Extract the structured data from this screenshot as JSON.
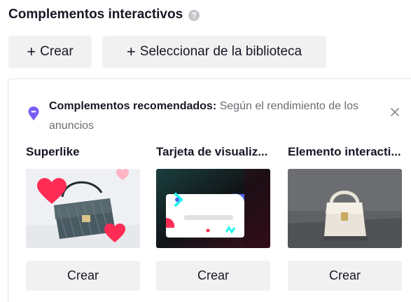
{
  "section": {
    "title": "Complementos interactivos",
    "help_icon": "question-icon"
  },
  "actions": {
    "create_label": "Crear",
    "library_label": "Seleccionar de la biblioteca",
    "plus_icon": "+"
  },
  "recommended": {
    "icon": "location-pin-icon",
    "label": "Complementos recomendados:",
    "description": "Según el rendimiento de los anuncios",
    "close_icon": "close-icon"
  },
  "cards": [
    {
      "title": "Superlike",
      "button_label": "Crear",
      "image": "handbag-with-hearts"
    },
    {
      "title": "Tarjeta de visualiz...",
      "button_label": "Crear",
      "image": "display-card-illustration"
    },
    {
      "title": "Elemento interacti...",
      "button_label": "Crear",
      "image": "white-handbag"
    }
  ],
  "colors": {
    "text_primary": "#161823",
    "text_secondary": "#6b6d73",
    "button_bg": "#f1f1f2",
    "accent_purple": "#7b5cf5",
    "heart_pink": "#fe2c55"
  }
}
